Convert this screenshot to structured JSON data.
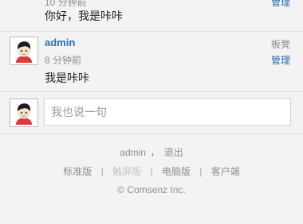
{
  "previous_comment": {
    "time": "10 分钟前",
    "manage_label": "管理",
    "text": "你好，我是咔咔"
  },
  "comment": {
    "author": "admin",
    "time": "8 分钟前",
    "floor_label": "板凳",
    "manage_label": "管理",
    "text": "我是咔咔",
    "avatar_icon": "default-avatar-icon"
  },
  "reply": {
    "placeholder": "我也说一句",
    "avatar_icon": "default-avatar-icon"
  },
  "footer": {
    "user": "admin",
    "comma": "，",
    "logout": "退出",
    "modes": [
      "标准版",
      "触屏版",
      "电脑版",
      "客户端"
    ],
    "separator": "|",
    "copyright": "© Comsenz Inc."
  },
  "colors": {
    "link": "#2a6fb0",
    "muted": "#8e8e8e",
    "disabled": "#c4c4c4",
    "background": "#f3f3f3"
  }
}
